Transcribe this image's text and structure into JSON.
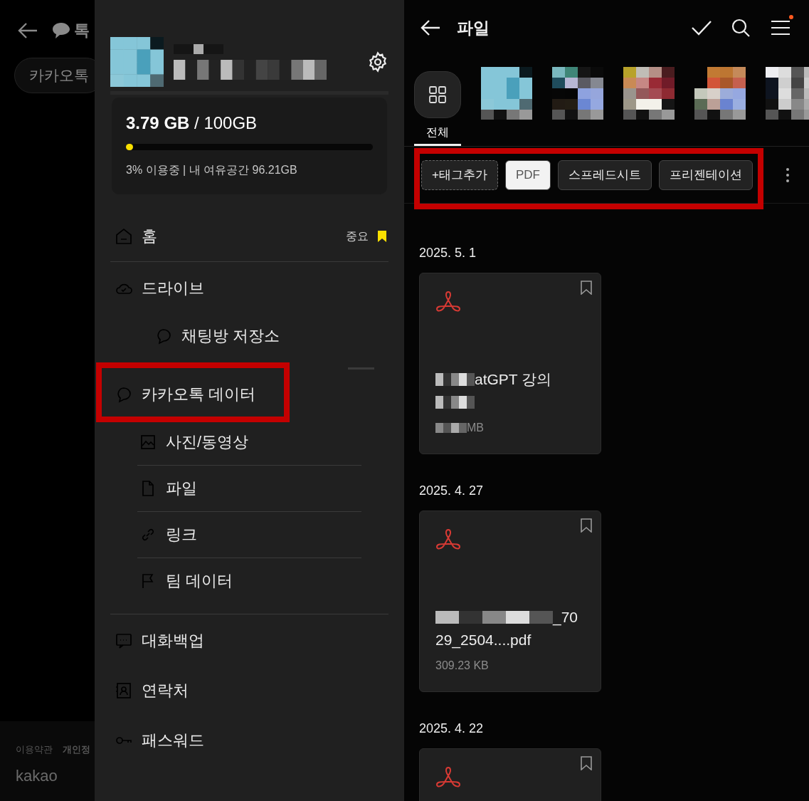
{
  "background_page": {
    "title": "톡",
    "chip": "카카오톡",
    "footer_links": [
      "이용약관",
      "개인정"
    ],
    "logo": "kakao"
  },
  "drawer": {
    "storage": {
      "used": "3.79 GB",
      "total": " / 100GB",
      "level": 0.03,
      "detail": "3% 이용중 | 내 여유공간 96.21GB"
    },
    "menu": [
      {
        "label": "홈",
        "badge": "중요"
      },
      {
        "label": "드라이브",
        "children": [
          {
            "label": "채팅방 저장소"
          }
        ]
      },
      {
        "label": "카카오톡 데이터",
        "children": [
          {
            "label": "사진/동영상"
          },
          {
            "label": "파일"
          },
          {
            "label": "링크"
          },
          {
            "label": "팀 데이터"
          }
        ]
      },
      {
        "label": "대화백업"
      },
      {
        "label": "연락처"
      },
      {
        "label": "패스워드"
      }
    ]
  },
  "files_screen": {
    "title": "파일",
    "albums": [
      {
        "kind": "all",
        "label": "전체",
        "selected": true
      },
      {
        "kind": "picture",
        "selected": false
      },
      {
        "kind": "picture",
        "selected": false
      },
      {
        "kind": "picture",
        "selected": false
      },
      {
        "kind": "picture",
        "selected": false
      },
      {
        "kind": "picture",
        "selected": false
      }
    ],
    "tags": [
      {
        "kind": "add",
        "label": "+태그추가",
        "selected": false
      },
      {
        "kind": "filter",
        "label": "PDF",
        "selected": true
      },
      {
        "kind": "filter",
        "label": "스프레드시트",
        "selected": false
      },
      {
        "kind": "filter",
        "label": "프리젠테이션",
        "selected": false
      }
    ],
    "groups": [
      {
        "date": "2025. 5. 1",
        "file": {
          "bookmarked": false,
          "name_lines": [
            {
              "text": "atGPT 강의",
              "redacted_prefix": true
            },
            {
              "redacted_prefix": true
            }
          ],
          "size": {
            "text": "MB",
            "redacted_prefix": true
          }
        }
      },
      {
        "date": "2025. 4. 27",
        "file": {
          "bookmarked": false,
          "name_lines": [
            {
              "text": "_70",
              "redacted_prefix": true
            },
            {
              "text": "29_2504....pdf",
              "redacted_prefix": false
            }
          ],
          "size": {
            "text": "309.23 KB",
            "redacted_prefix": false
          }
        }
      },
      {
        "date": "2025. 4. 22",
        "file": {
          "bookmarked": false
        }
      }
    ]
  }
}
